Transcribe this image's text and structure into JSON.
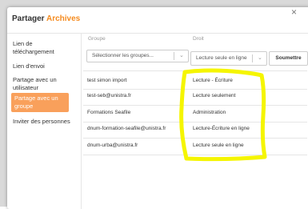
{
  "dialog": {
    "title_prefix": "Partager ",
    "title_library": "Archives",
    "close_symbol": "×"
  },
  "sidebar": {
    "items": [
      {
        "label": "Lien de téléchargement"
      },
      {
        "label": "Lien d'envoi"
      },
      {
        "label": "Partage avec un utilisateur"
      },
      {
        "label": "Partage avec un groupe",
        "active": true
      },
      {
        "label": "Inviter des personnes"
      }
    ]
  },
  "form": {
    "group_header": "Groupe",
    "right_header": "Droit",
    "group_placeholder": "Sélectionner les groupes...",
    "right_value": "Lecture seule en ligne",
    "submit_label": "Soumettre"
  },
  "rows": [
    {
      "group": "test simon import",
      "right": "Lecture - Écriture"
    },
    {
      "group": "test-seb@unistra.fr",
      "right": "Lecture seulement"
    },
    {
      "group": "Formations Seafile",
      "right": "Administration"
    },
    {
      "group": "dnum-formation-seafile@unistra.fr",
      "right": "Lecture-Écriture en ligne"
    },
    {
      "group": "dnum-urba@unistra.fr",
      "right": "Lecture seule en ligne"
    }
  ],
  "colors": {
    "accent": "#f58b1f",
    "active_nav": "#f9a05b",
    "highlight_marker": "#f5f500"
  }
}
